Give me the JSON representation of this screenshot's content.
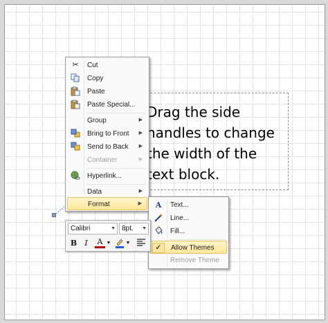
{
  "canvas": {
    "text_block": "Drag the side\nhandles to change\nthe width of the\ntext block."
  },
  "context_menu": {
    "items": [
      {
        "label": "Cut",
        "icon": "scissors-icon",
        "enabled": true,
        "submenu": false
      },
      {
        "label": "Copy",
        "icon": "copy-icon",
        "enabled": true,
        "submenu": false
      },
      {
        "label": "Paste",
        "icon": "paste-icon",
        "enabled": true,
        "submenu": false
      },
      {
        "label": "Paste Special...",
        "icon": "paste-special-icon",
        "enabled": true,
        "submenu": false
      },
      {
        "label": "Group",
        "icon": "",
        "enabled": true,
        "submenu": true
      },
      {
        "label": "Bring to Front",
        "icon": "bring-to-front-icon",
        "enabled": true,
        "submenu": true
      },
      {
        "label": "Send to Back",
        "icon": "send-to-back-icon",
        "enabled": true,
        "submenu": true
      },
      {
        "label": "Container",
        "icon": "",
        "enabled": false,
        "submenu": true
      },
      {
        "label": "Hyperlink...",
        "icon": "hyperlink-icon",
        "enabled": true,
        "submenu": false
      },
      {
        "label": "Data",
        "icon": "",
        "enabled": true,
        "submenu": true
      },
      {
        "label": "Format",
        "icon": "",
        "enabled": true,
        "submenu": true,
        "highlighted": true
      }
    ]
  },
  "format_submenu": {
    "items": [
      {
        "label": "Text...",
        "icon": "text-format-icon",
        "enabled": true
      },
      {
        "label": "Line...",
        "icon": "line-format-icon",
        "enabled": true
      },
      {
        "label": "Fill...",
        "icon": "fill-bucket-icon",
        "enabled": true
      },
      {
        "label": "Allow Themes",
        "icon": "checkmark-icon",
        "enabled": true,
        "checked": true,
        "highlighted": true
      },
      {
        "label": "Remove Theme",
        "icon": "",
        "enabled": false
      }
    ]
  },
  "mini_toolbar": {
    "font_name": "Calibri",
    "font_size": "8pt.",
    "bold_label": "B",
    "italic_label": "I",
    "font_color_label": "A",
    "font_color": "#c00000",
    "highlight_color": "#1f5fd6"
  },
  "colors": {
    "menu_highlight": "#ffe69a",
    "check_background": "#fce4a6"
  }
}
